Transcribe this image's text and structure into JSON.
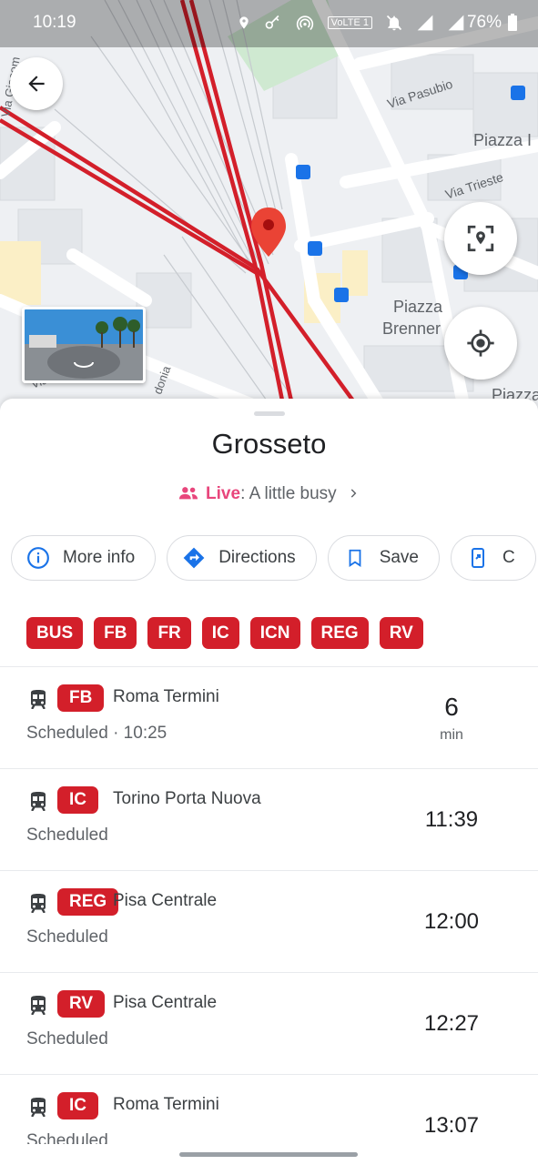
{
  "status_bar": {
    "time": "10:19",
    "battery": "76%",
    "volte_label": "VoLTE 1"
  },
  "map": {
    "labels": [
      "Via Pasubio",
      "Piazza I",
      "Via Trieste",
      "Piazza",
      "Brenner",
      "Piazza",
      "Via Giacom",
      "Via",
      "donia"
    ],
    "icons": [
      "back-arrow-icon",
      "streetview-thumbnail",
      "location-pin-icon",
      "my-location-icon",
      "location-scan-icon"
    ]
  },
  "place": {
    "title": "Grosseto",
    "live_word": "Live",
    "live_status": ": A little busy"
  },
  "actions": [
    {
      "label": "More info",
      "icon": "info-icon"
    },
    {
      "label": "Directions",
      "icon": "directions-icon"
    },
    {
      "label": "Save",
      "icon": "bookmark-icon"
    },
    {
      "label": "C",
      "icon": "share-icon"
    }
  ],
  "tags": [
    "BUS",
    "FB",
    "FR",
    "IC",
    "ICN",
    "REG",
    "RV"
  ],
  "departures": [
    {
      "line": "FB",
      "destination": "Roma Termini",
      "status": "Scheduled · 10:25",
      "time": "6",
      "unit": "min"
    },
    {
      "line": "IC",
      "destination": "Torino Porta Nuova",
      "status": "Scheduled",
      "time": "11:39",
      "unit": ""
    },
    {
      "line": "REG",
      "destination": "Pisa Centrale",
      "status": "Scheduled",
      "time": "12:00",
      "unit": ""
    },
    {
      "line": "RV",
      "destination": "Pisa Centrale",
      "status": "Scheduled",
      "time": "12:27",
      "unit": ""
    },
    {
      "line": "IC",
      "destination": "Roma Termini",
      "status": "Scheduled",
      "time": "13:07",
      "unit": ""
    }
  ],
  "colors": {
    "rail_red": "#d31f2a",
    "live_pink": "#e8467c",
    "google_blue": "#1a73e8",
    "pin_red": "#ea4335"
  }
}
